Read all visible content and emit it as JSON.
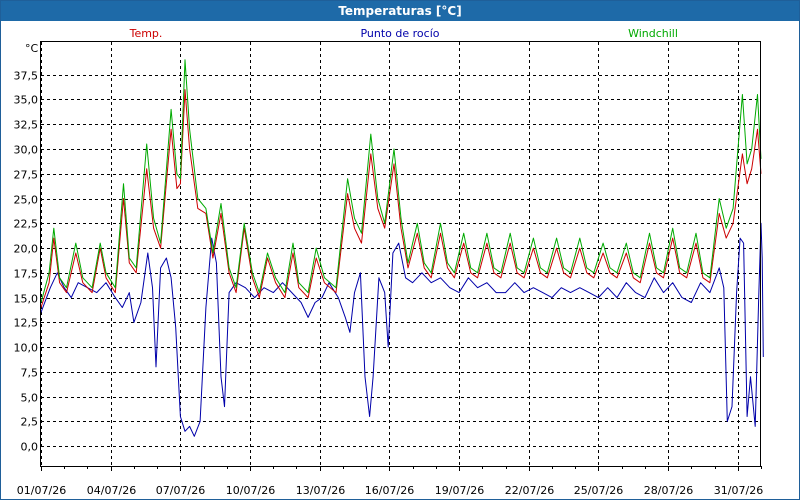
{
  "window": {
    "title": "Temperaturas [°C]"
  },
  "chart_data": {
    "type": "line",
    "ylabel": "°C",
    "ylim": [
      -2.0,
      40.8
    ],
    "xlim": [
      0,
      31
    ],
    "grid": true,
    "yticks": [
      0,
      2.5,
      5,
      7.5,
      10,
      12.5,
      15,
      17.5,
      20,
      22.5,
      25,
      27.5,
      30,
      32.5,
      35,
      37.5
    ],
    "ytick_labels": [
      "0,0",
      "2,5",
      "5,0",
      "7,5",
      "10,0",
      "12,5",
      "15,0",
      "17,5",
      "20,0",
      "22,5",
      "25,0",
      "27,5",
      "30,0",
      "32,5",
      "35,0",
      "37,5"
    ],
    "xticks": [
      0,
      3,
      6,
      9,
      12,
      15,
      18,
      21,
      24,
      27,
      30
    ],
    "xtick_labels": [
      "01/07/26",
      "04/07/26",
      "07/07/26",
      "10/07/26",
      "13/07/26",
      "16/07/26",
      "19/07/26",
      "22/07/26",
      "25/07/26",
      "28/07/26",
      "31/07/26"
    ],
    "x_unit": "days from 01/07/26",
    "series": [
      {
        "name": "Temp.",
        "color": "#cc0000",
        "points": [
          [
            0,
            14.0
          ],
          [
            0.35,
            16.5
          ],
          [
            0.55,
            21.0
          ],
          [
            0.8,
            16.5
          ],
          [
            1.1,
            15.5
          ],
          [
            1.5,
            19.5
          ],
          [
            1.8,
            16.5
          ],
          [
            2.2,
            15.5
          ],
          [
            2.55,
            20.0
          ],
          [
            2.8,
            17.0
          ],
          [
            3.2,
            15.5
          ],
          [
            3.55,
            25.0
          ],
          [
            3.8,
            18.5
          ],
          [
            4.1,
            17.5
          ],
          [
            4.55,
            28.0
          ],
          [
            4.85,
            22.0
          ],
          [
            5.15,
            20.0
          ],
          [
            5.6,
            32.0
          ],
          [
            5.85,
            26.0
          ],
          [
            6.0,
            26.5
          ],
          [
            6.2,
            36.0
          ],
          [
            6.4,
            30.0
          ],
          [
            6.75,
            24.0
          ],
          [
            7.1,
            23.5
          ],
          [
            7.4,
            19.0
          ],
          [
            7.75,
            23.5
          ],
          [
            8.1,
            17.5
          ],
          [
            8.4,
            15.5
          ],
          [
            8.75,
            22.0
          ],
          [
            9.1,
            17.0
          ],
          [
            9.4,
            15.0
          ],
          [
            9.75,
            19.0
          ],
          [
            10.1,
            16.5
          ],
          [
            10.5,
            15.0
          ],
          [
            10.85,
            19.5
          ],
          [
            11.1,
            16.0
          ],
          [
            11.5,
            15.0
          ],
          [
            11.85,
            19.0
          ],
          [
            12.2,
            16.5
          ],
          [
            12.7,
            15.5
          ],
          [
            13.2,
            25.5
          ],
          [
            13.5,
            22.0
          ],
          [
            13.8,
            20.5
          ],
          [
            14.2,
            29.5
          ],
          [
            14.5,
            24.0
          ],
          [
            14.8,
            22.0
          ],
          [
            15.2,
            28.5
          ],
          [
            15.5,
            22.0
          ],
          [
            15.8,
            18.0
          ],
          [
            16.2,
            21.5
          ],
          [
            16.5,
            18.0
          ],
          [
            16.8,
            17.0
          ],
          [
            17.2,
            21.5
          ],
          [
            17.5,
            18.0
          ],
          [
            17.8,
            17.0
          ],
          [
            18.2,
            20.5
          ],
          [
            18.5,
            17.5
          ],
          [
            18.8,
            17.0
          ],
          [
            19.2,
            20.5
          ],
          [
            19.5,
            17.5
          ],
          [
            19.8,
            17.0
          ],
          [
            20.2,
            20.5
          ],
          [
            20.5,
            17.5
          ],
          [
            20.8,
            17.0
          ],
          [
            21.2,
            20.0
          ],
          [
            21.5,
            17.5
          ],
          [
            21.8,
            17.0
          ],
          [
            22.2,
            20.0
          ],
          [
            22.5,
            17.5
          ],
          [
            22.8,
            17.0
          ],
          [
            23.2,
            20.0
          ],
          [
            23.5,
            17.5
          ],
          [
            23.8,
            17.0
          ],
          [
            24.2,
            19.5
          ],
          [
            24.5,
            17.5
          ],
          [
            24.8,
            17.0
          ],
          [
            25.2,
            19.5
          ],
          [
            25.5,
            17.0
          ],
          [
            25.8,
            16.5
          ],
          [
            26.2,
            20.5
          ],
          [
            26.5,
            17.5
          ],
          [
            26.8,
            17.0
          ],
          [
            27.2,
            21.0
          ],
          [
            27.5,
            17.5
          ],
          [
            27.8,
            17.0
          ],
          [
            28.2,
            20.5
          ],
          [
            28.5,
            17.0
          ],
          [
            28.8,
            16.5
          ],
          [
            29.2,
            23.5
          ],
          [
            29.5,
            21.0
          ],
          [
            29.8,
            22.5
          ],
          [
            30.2,
            29.5
          ],
          [
            30.4,
            26.5
          ],
          [
            30.6,
            28.0
          ],
          [
            30.85,
            32.0
          ],
          [
            31.0,
            27.5
          ]
        ]
      },
      {
        "name": "Punto de rocío",
        "color": "#0000aa",
        "points": [
          [
            0,
            13.5
          ],
          [
            0.4,
            16.0
          ],
          [
            0.7,
            17.5
          ],
          [
            1.0,
            16.0
          ],
          [
            1.3,
            15.0
          ],
          [
            1.6,
            16.5
          ],
          [
            2.0,
            16.0
          ],
          [
            2.4,
            15.5
          ],
          [
            2.8,
            16.5
          ],
          [
            3.2,
            15.0
          ],
          [
            3.5,
            14.0
          ],
          [
            3.8,
            15.5
          ],
          [
            4.0,
            12.5
          ],
          [
            4.3,
            14.5
          ],
          [
            4.6,
            19.5
          ],
          [
            4.8,
            16.0
          ],
          [
            4.95,
            8.0
          ],
          [
            5.15,
            18.0
          ],
          [
            5.4,
            19.0
          ],
          [
            5.6,
            17.0
          ],
          [
            5.8,
            12.0
          ],
          [
            6.0,
            3.0
          ],
          [
            6.2,
            1.5
          ],
          [
            6.4,
            2.0
          ],
          [
            6.6,
            1.0
          ],
          [
            6.85,
            2.5
          ],
          [
            7.1,
            14.0
          ],
          [
            7.35,
            21.0
          ],
          [
            7.55,
            18.5
          ],
          [
            7.75,
            7.0
          ],
          [
            7.9,
            4.0
          ],
          [
            8.1,
            15.5
          ],
          [
            8.4,
            16.5
          ],
          [
            8.8,
            16.0
          ],
          [
            9.2,
            15.0
          ],
          [
            9.6,
            16.0
          ],
          [
            10.0,
            15.5
          ],
          [
            10.4,
            16.5
          ],
          [
            10.8,
            15.5
          ],
          [
            11.2,
            14.5
          ],
          [
            11.5,
            13.0
          ],
          [
            11.8,
            14.5
          ],
          [
            12.1,
            15.0
          ],
          [
            12.4,
            16.5
          ],
          [
            12.8,
            15.0
          ],
          [
            13.1,
            13.0
          ],
          [
            13.3,
            11.5
          ],
          [
            13.5,
            15.5
          ],
          [
            13.75,
            17.5
          ],
          [
            13.95,
            7.0
          ],
          [
            14.15,
            3.0
          ],
          [
            14.3,
            7.0
          ],
          [
            14.55,
            17.0
          ],
          [
            14.8,
            15.5
          ],
          [
            14.95,
            10.0
          ],
          [
            15.15,
            19.5
          ],
          [
            15.4,
            20.5
          ],
          [
            15.7,
            17.0
          ],
          [
            16.0,
            16.5
          ],
          [
            16.4,
            17.5
          ],
          [
            16.8,
            16.5
          ],
          [
            17.2,
            17.0
          ],
          [
            17.6,
            16.0
          ],
          [
            18.0,
            15.5
          ],
          [
            18.4,
            17.0
          ],
          [
            18.8,
            16.0
          ],
          [
            19.2,
            16.5
          ],
          [
            19.6,
            15.5
          ],
          [
            20.0,
            15.5
          ],
          [
            20.4,
            16.5
          ],
          [
            20.8,
            15.5
          ],
          [
            21.2,
            16.0
          ],
          [
            21.6,
            15.5
          ],
          [
            22.0,
            15.0
          ],
          [
            22.4,
            16.0
          ],
          [
            22.8,
            15.5
          ],
          [
            23.2,
            16.0
          ],
          [
            23.6,
            15.5
          ],
          [
            24.0,
            15.0
          ],
          [
            24.4,
            16.0
          ],
          [
            24.8,
            15.0
          ],
          [
            25.2,
            16.5
          ],
          [
            25.6,
            15.5
          ],
          [
            26.0,
            15.0
          ],
          [
            26.4,
            17.0
          ],
          [
            26.8,
            15.5
          ],
          [
            27.2,
            16.5
          ],
          [
            27.6,
            15.0
          ],
          [
            28.0,
            14.5
          ],
          [
            28.4,
            16.5
          ],
          [
            28.8,
            15.5
          ],
          [
            29.2,
            18.0
          ],
          [
            29.4,
            16.0
          ],
          [
            29.55,
            2.5
          ],
          [
            29.75,
            4.0
          ],
          [
            29.95,
            15.5
          ],
          [
            30.1,
            21.0
          ],
          [
            30.25,
            20.5
          ],
          [
            30.4,
            3.0
          ],
          [
            30.55,
            7.0
          ],
          [
            30.75,
            2.0
          ],
          [
            30.9,
            15.0
          ],
          [
            31.0,
            22.5
          ],
          [
            31.05,
            19.0
          ],
          [
            31.1,
            9.0
          ]
        ]
      },
      {
        "name": "Windchill",
        "color": "#00aa00",
        "points": [
          [
            0,
            14.5
          ],
          [
            0.35,
            17.5
          ],
          [
            0.55,
            22.0
          ],
          [
            0.8,
            17.0
          ],
          [
            1.1,
            16.0
          ],
          [
            1.5,
            20.5
          ],
          [
            1.8,
            17.0
          ],
          [
            2.2,
            16.0
          ],
          [
            2.55,
            20.5
          ],
          [
            2.8,
            17.5
          ],
          [
            3.2,
            16.0
          ],
          [
            3.55,
            26.5
          ],
          [
            3.8,
            19.0
          ],
          [
            4.1,
            18.0
          ],
          [
            4.55,
            30.5
          ],
          [
            4.85,
            23.0
          ],
          [
            5.15,
            20.5
          ],
          [
            5.6,
            34.0
          ],
          [
            5.85,
            27.5
          ],
          [
            6.0,
            27.0
          ],
          [
            6.2,
            39.0
          ],
          [
            6.4,
            32.0
          ],
          [
            6.75,
            25.0
          ],
          [
            7.1,
            24.0
          ],
          [
            7.4,
            19.5
          ],
          [
            7.75,
            24.5
          ],
          [
            8.1,
            18.0
          ],
          [
            8.4,
            16.0
          ],
          [
            8.75,
            22.5
          ],
          [
            9.1,
            17.5
          ],
          [
            9.4,
            15.5
          ],
          [
            9.75,
            19.5
          ],
          [
            10.1,
            17.0
          ],
          [
            10.5,
            15.5
          ],
          [
            10.85,
            20.5
          ],
          [
            11.1,
            16.5
          ],
          [
            11.5,
            15.5
          ],
          [
            11.85,
            20.0
          ],
          [
            12.2,
            17.0
          ],
          [
            12.7,
            16.0
          ],
          [
            13.2,
            27.0
          ],
          [
            13.5,
            23.0
          ],
          [
            13.8,
            21.5
          ],
          [
            14.2,
            31.5
          ],
          [
            14.5,
            25.0
          ],
          [
            14.8,
            22.5
          ],
          [
            15.2,
            30.0
          ],
          [
            15.5,
            23.0
          ],
          [
            15.8,
            18.5
          ],
          [
            16.2,
            22.5
          ],
          [
            16.5,
            18.5
          ],
          [
            16.8,
            17.5
          ],
          [
            17.2,
            22.5
          ],
          [
            17.5,
            18.5
          ],
          [
            17.8,
            17.5
          ],
          [
            18.2,
            21.5
          ],
          [
            18.5,
            18.0
          ],
          [
            18.8,
            17.5
          ],
          [
            19.2,
            21.5
          ],
          [
            19.5,
            18.0
          ],
          [
            19.8,
            17.5
          ],
          [
            20.2,
            21.5
          ],
          [
            20.5,
            18.0
          ],
          [
            20.8,
            17.5
          ],
          [
            21.2,
            21.0
          ],
          [
            21.5,
            18.0
          ],
          [
            21.8,
            17.5
          ],
          [
            22.2,
            21.0
          ],
          [
            22.5,
            18.0
          ],
          [
            22.8,
            17.5
          ],
          [
            23.2,
            21.0
          ],
          [
            23.5,
            18.0
          ],
          [
            23.8,
            17.5
          ],
          [
            24.2,
            20.5
          ],
          [
            24.5,
            18.0
          ],
          [
            24.8,
            17.5
          ],
          [
            25.2,
            20.5
          ],
          [
            25.5,
            17.5
          ],
          [
            25.8,
            17.0
          ],
          [
            26.2,
            21.5
          ],
          [
            26.5,
            18.0
          ],
          [
            26.8,
            17.5
          ],
          [
            27.2,
            22.0
          ],
          [
            27.5,
            18.0
          ],
          [
            27.8,
            17.5
          ],
          [
            28.2,
            21.5
          ],
          [
            28.5,
            17.5
          ],
          [
            28.8,
            17.0
          ],
          [
            29.2,
            25.0
          ],
          [
            29.5,
            22.0
          ],
          [
            29.8,
            24.0
          ],
          [
            30.2,
            35.5
          ],
          [
            30.4,
            28.5
          ],
          [
            30.6,
            30.0
          ],
          [
            30.85,
            35.5
          ],
          [
            31.0,
            29.0
          ]
        ]
      }
    ]
  }
}
